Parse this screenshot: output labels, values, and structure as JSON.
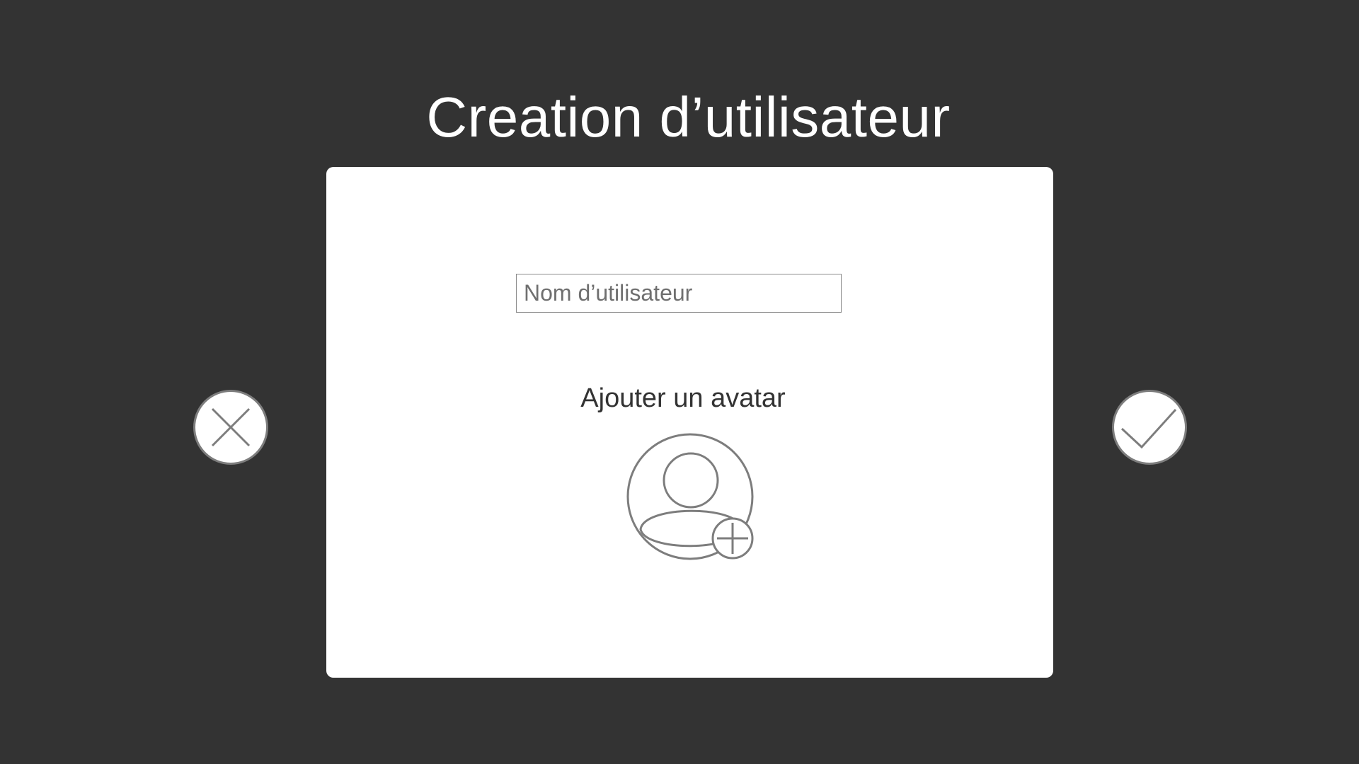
{
  "page": {
    "title": "Creation d’utilisateur"
  },
  "form": {
    "username_placeholder": "Nom d’utilisateur",
    "username_value": "",
    "avatar_label": "Ajouter un avatar"
  },
  "actions": {
    "cancel_icon": "close-icon",
    "confirm_icon": "checkmark-icon"
  },
  "colors": {
    "background": "#333333",
    "card": "#ffffff",
    "icon_stroke": "#7d7d7d",
    "title_text": "#ffffff",
    "body_text": "#333333"
  }
}
